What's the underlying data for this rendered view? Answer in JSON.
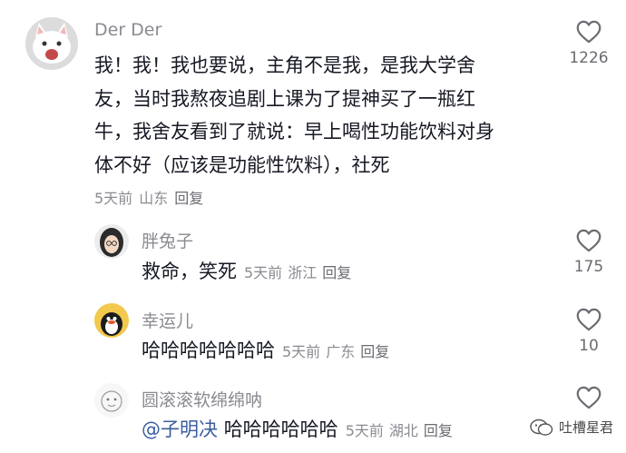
{
  "comments": [
    {
      "username": "Der Der",
      "lines": [
        "我！我！我也要说，主角不是我，是我大学舍",
        "友，当时我熬夜追剧上课为了提神买了一瓶红",
        "牛，我舍友看到了就说：早上喝性功能饮料对身",
        "体不好（应该是功能性饮料），社死"
      ],
      "time": "5天前",
      "location": "山东",
      "reply_label": "回复",
      "likes": "1226"
    }
  ],
  "replies": [
    {
      "username": "胖兔子",
      "text": "救命，笑死",
      "time": "5天前",
      "location": "浙江",
      "reply_label": "回复",
      "likes": "175"
    },
    {
      "username": "幸运儿",
      "text": "哈哈哈哈哈哈哈",
      "time": "5天前",
      "location": "广东",
      "reply_label": "回复",
      "likes": "10"
    },
    {
      "username": "圆滚滚软绵绵呐",
      "mention": "@子明决",
      "text": "哈哈哈哈哈哈",
      "time": "5天前",
      "location": "湖北",
      "reply_label": "回复",
      "likes": ""
    }
  ],
  "watermark": {
    "text": "吐槽星君"
  }
}
